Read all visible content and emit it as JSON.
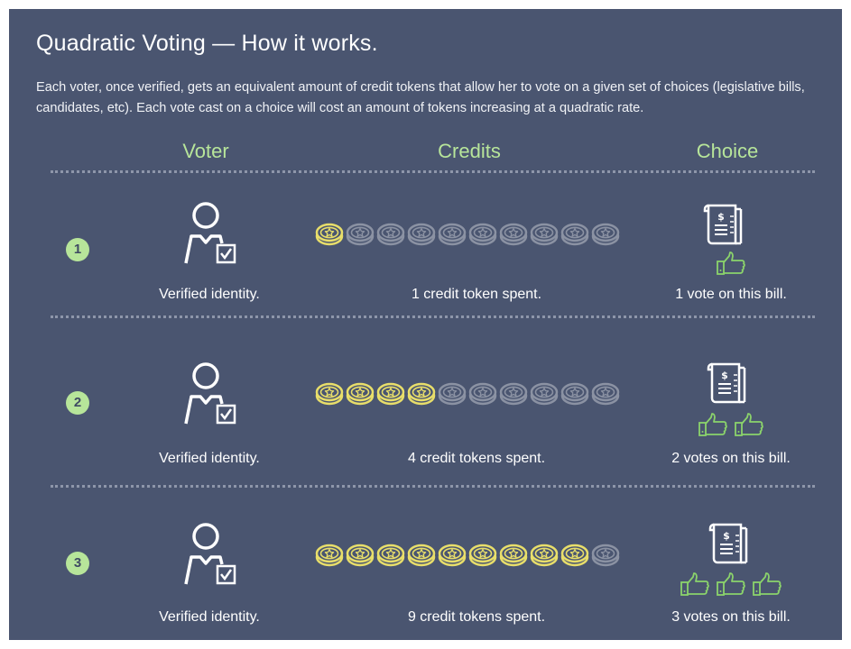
{
  "title": "Quadratic Voting — How it works.",
  "intro": "Each voter, once verified, gets an equivalent amount of credit tokens that allow her to vote on a given set of choices (legislative bills, candidates, etc). Each vote cast on a choice will cost an amount of tokens increasing at a quadratic rate.",
  "columns": {
    "voter": "Voter",
    "credits": "Credits",
    "choice": "Choice"
  },
  "colors": {
    "panel": "#4a5570",
    "accent": "#b7e59a",
    "coin_active": "#e8de6a",
    "coin_inactive": "#8b92a3",
    "thumb": "#8bd36b"
  },
  "total_tokens": 10,
  "rows": [
    {
      "number": "1",
      "voter_caption": "Verified identity.",
      "tokens_spent": 1,
      "tokens_caption": "1 credit token spent.",
      "votes": 1,
      "choice_caption": "1 vote on this bill."
    },
    {
      "number": "2",
      "voter_caption": "Verified identity.",
      "tokens_spent": 4,
      "tokens_caption": "4 credit tokens spent.",
      "votes": 2,
      "choice_caption": "2 votes on this bill."
    },
    {
      "number": "3",
      "voter_caption": "Verified identity.",
      "tokens_spent": 9,
      "tokens_caption": "9 credit tokens spent.",
      "votes": 3,
      "choice_caption": "3 votes on this bill."
    }
  ]
}
